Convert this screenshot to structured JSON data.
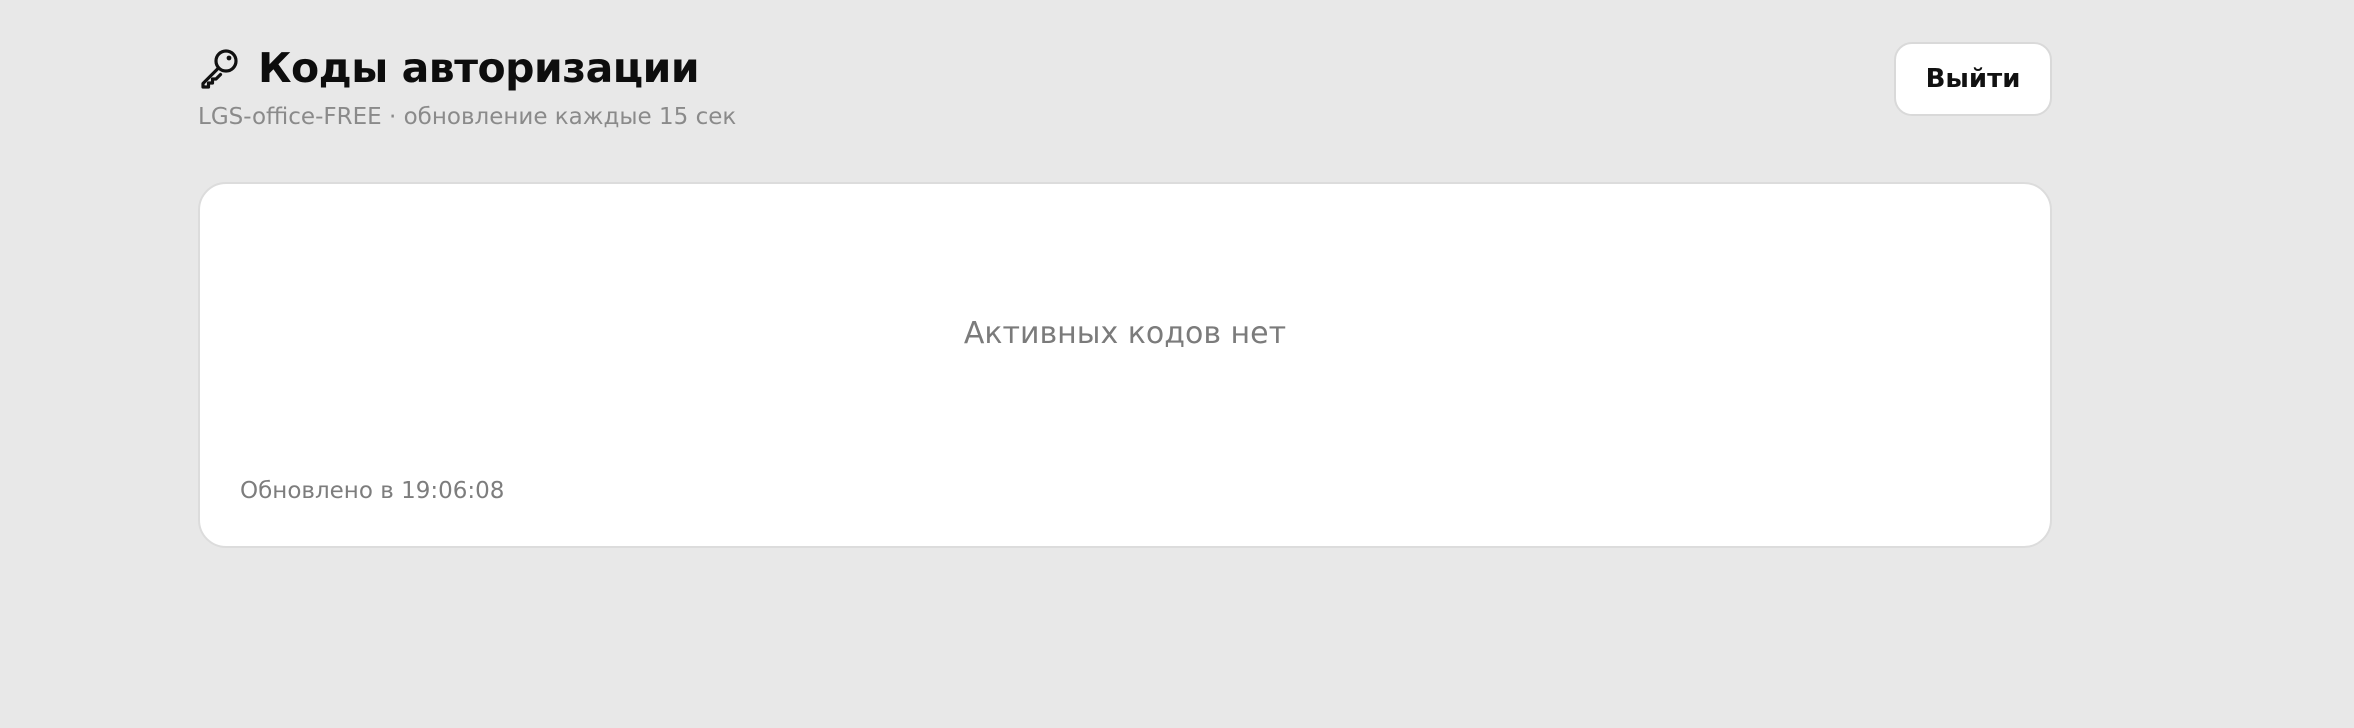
{
  "header": {
    "icon": "key-icon",
    "title": "Коды авторизации",
    "subtitle": "LGS-office-FREE · обновление каждые 15 сек"
  },
  "actions": {
    "logout_label": "Выйти"
  },
  "codes_panel": {
    "empty_message": "Активных кодов нет",
    "updated_label": "Обновлено в 19:06:08"
  },
  "colors": {
    "background": "#e8e8e8",
    "card": "#ffffff",
    "title": "#0d0d0d",
    "muted_text": "#8a8a8a"
  }
}
